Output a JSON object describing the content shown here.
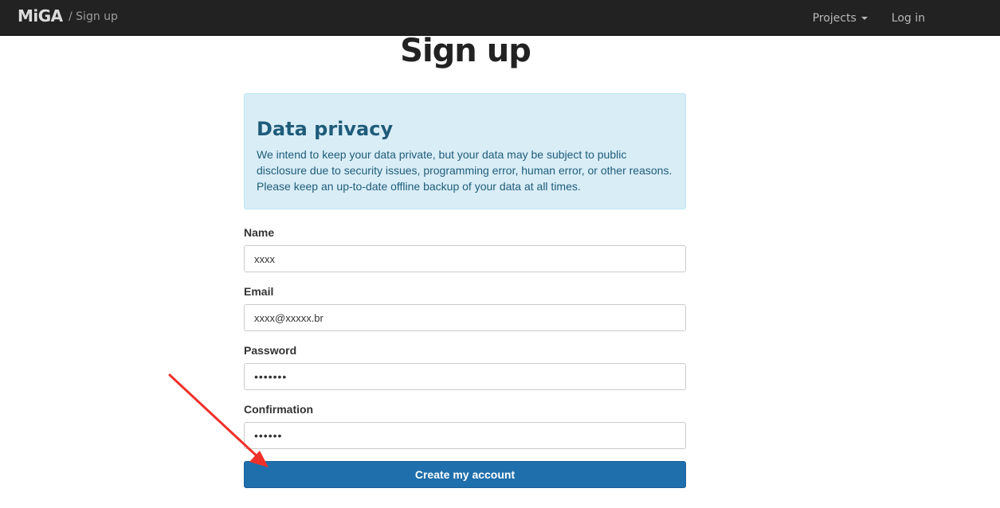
{
  "navbar": {
    "brand": "MiGA",
    "breadcrumb": "/ Sign up",
    "projects_label": "Projects",
    "login_label": "Log in"
  },
  "page": {
    "title": "Sign up"
  },
  "privacy": {
    "heading": "Data privacy",
    "text": "We intend to keep your data private, but your data may be subject to public disclosure due to security issues, programming error, human error, or other reasons. Please keep an up-to-date offline backup of your data at all times."
  },
  "form": {
    "name_label": "Name",
    "name_value": "xxxx",
    "email_label": "Email",
    "email_value": "xxxx@xxxxx.br",
    "password_label": "Password",
    "password_value": "•••••••",
    "confirmation_label": "Confirmation",
    "confirmation_value": "••••••",
    "submit_label": "Create my account"
  },
  "colors": {
    "navbar_bg": "#222222",
    "alert_bg": "#d9edf7",
    "alert_text": "#1f5c7a",
    "button_bg": "#1f6fad",
    "annotation_arrow": "#f0302a"
  },
  "icons": {
    "projects_dropdown": "caret-down-icon",
    "annotation": "red-arrow-annotation"
  }
}
